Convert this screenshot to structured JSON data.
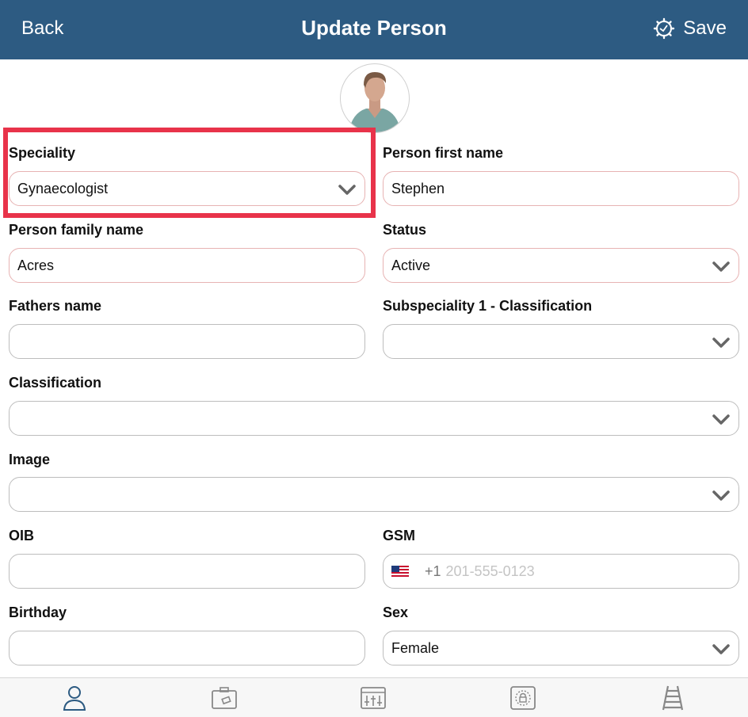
{
  "header": {
    "back_label": "Back",
    "title": "Update Person",
    "save_label": "Save",
    "save_icon": "gear-icon",
    "background": "#2d5b82"
  },
  "highlight_color": "#e8334a",
  "form": {
    "speciality": {
      "label": "Speciality",
      "value": "Gynaecologist"
    },
    "first_name": {
      "label": "Person first name",
      "value": "Stephen"
    },
    "family_name": {
      "label": "Person family name",
      "value": "Acres"
    },
    "status": {
      "label": "Status",
      "value": "Active"
    },
    "fathers_name": {
      "label": "Fathers name",
      "value": ""
    },
    "subspeciality": {
      "label": "Subspeciality 1 - Classification",
      "value": ""
    },
    "classification": {
      "label": "Classification",
      "value": ""
    },
    "image": {
      "label": "Image",
      "value": ""
    },
    "oib": {
      "label": "OIB",
      "value": ""
    },
    "gsm": {
      "label": "GSM",
      "prefix": "+1",
      "placeholder": "201-555-0123",
      "flag_icon": "us-flag-icon"
    },
    "birthday": {
      "label": "Birthday",
      "value": ""
    },
    "sex": {
      "label": "Sex",
      "value": "Female"
    }
  },
  "tabs": [
    {
      "name": "person-tab",
      "icon": "person-icon",
      "active": true
    },
    {
      "name": "card-tab",
      "icon": "id-card-icon",
      "active": false
    },
    {
      "name": "settings-tab",
      "icon": "sliders-icon",
      "active": false
    },
    {
      "name": "security-tab",
      "icon": "lock-icon",
      "active": false
    },
    {
      "name": "ladder-tab",
      "icon": "ladder-icon",
      "active": false
    }
  ]
}
